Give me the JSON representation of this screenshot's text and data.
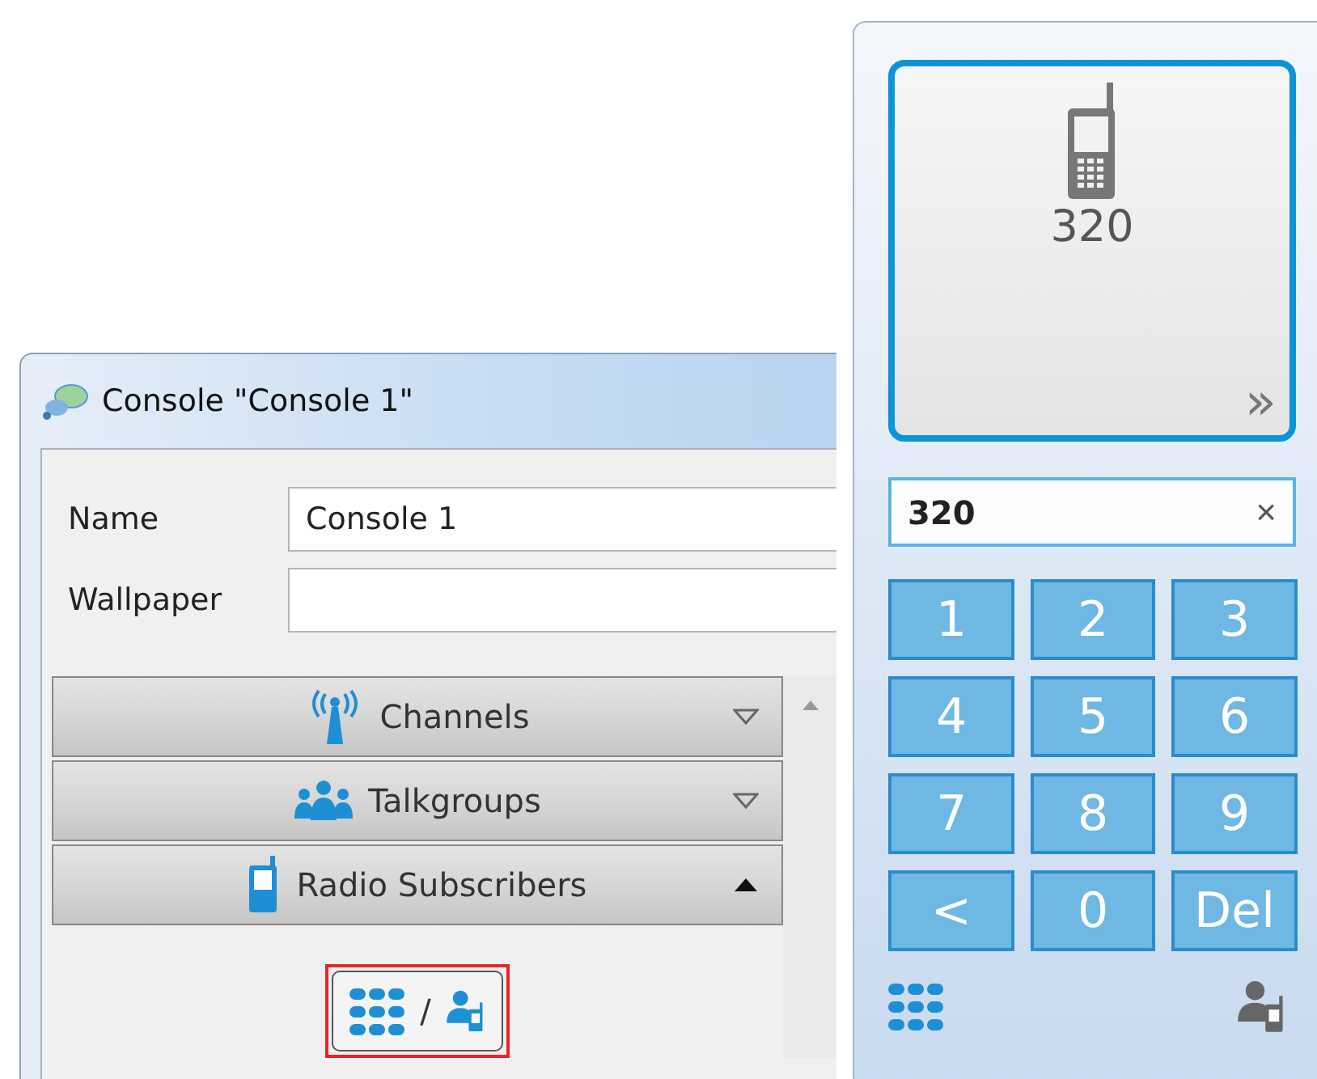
{
  "console_window": {
    "title": "Console \"Console 1\"",
    "fields": [
      {
        "label": "Name",
        "value": "Console 1"
      },
      {
        "label": "Wallpaper"
      }
    ],
    "sections": [
      {
        "kind": "antenna",
        "label": "Channels",
        "expanded": false
      },
      {
        "kind": "group",
        "label": "Talkgroups",
        "expanded": false
      },
      {
        "kind": "handset",
        "label": "Radio Subscribers",
        "expanded": true
      }
    ],
    "toggle_button": {
      "separator": "/",
      "highlighted": true
    }
  },
  "dial_panel": {
    "contact": {
      "number": "320",
      "selected": true,
      "more": "»"
    },
    "input": {
      "value": "320",
      "clear": "×"
    },
    "keys": [
      "1",
      "2",
      "3",
      "4",
      "5",
      "6",
      "7",
      "8",
      "9",
      "<",
      "0",
      "Del"
    ],
    "modes": [
      {
        "kind": "keypad",
        "selected": true
      },
      {
        "kind": "contacts",
        "selected": false
      }
    ]
  }
}
